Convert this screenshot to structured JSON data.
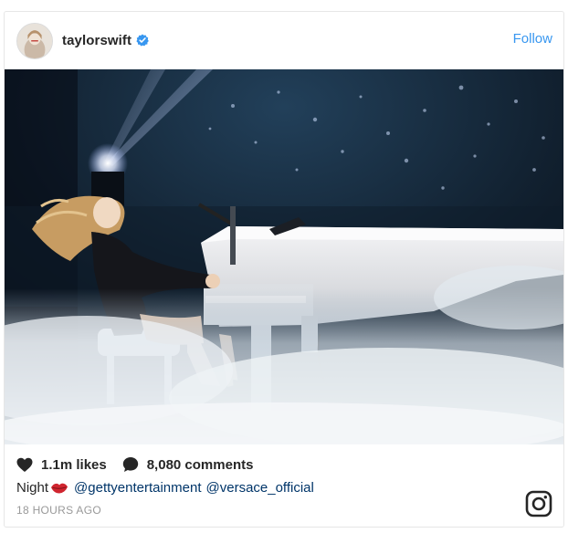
{
  "post": {
    "username": "taylorswift",
    "verified": true,
    "follow_label": "Follow",
    "image_alt": "Taylor Swift playing a white grand piano on a foggy stage",
    "likes": "1.1m likes",
    "comments": "8,080 comments",
    "caption_text": "Night",
    "caption_emoji": "lips-icon",
    "mentions": [
      "@gettyentertainment",
      "@versace_official"
    ],
    "timestamp": "18 HOURS AGO"
  },
  "icons": {
    "verified": "verified-badge-icon",
    "like": "heart-icon",
    "comment": "comment-bubble-icon",
    "brand": "instagram-icon"
  },
  "colors": {
    "link": "#3897f0",
    "mention": "#003569",
    "muted": "#999999",
    "text": "#262626",
    "lips": "#d0252f"
  }
}
